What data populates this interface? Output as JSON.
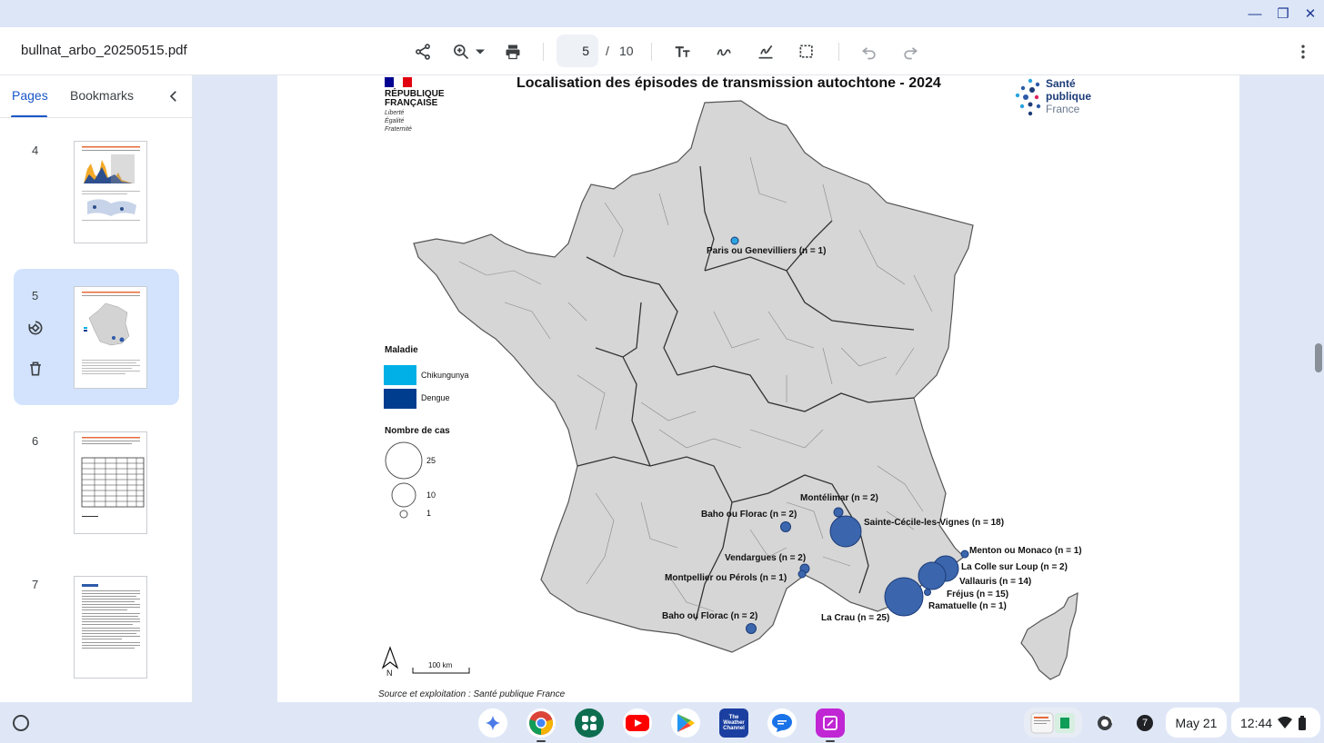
{
  "window": {
    "minimize_icon": "minimize-icon",
    "maximize_icon": "maximize-icon",
    "close_icon": "close-icon"
  },
  "toolbar": {
    "filename": "bullnat_arbo_20250515.pdf",
    "page_current": "5",
    "page_separator": "/",
    "page_total": "10"
  },
  "sidebar": {
    "tabs": [
      "Pages",
      "Bookmarks"
    ],
    "thumbnails": [
      {
        "page": "4"
      },
      {
        "page": "5",
        "selected": true
      },
      {
        "page": "6"
      },
      {
        "page": "7"
      }
    ]
  },
  "document": {
    "map_title": "Localisation des épisodes de transmission autochtone - 2024",
    "republic_logo": [
      "RÉPUBLIQUE",
      "FRANÇAISE"
    ],
    "republic_motto": [
      "Liberté",
      "Égalité",
      "Fraternité"
    ],
    "spf_logo": [
      "Santé",
      "publique",
      "France"
    ],
    "legend": {
      "disease_title": "Maladie",
      "diseases": [
        {
          "label": "Chikungunya",
          "color": "#00b0e6"
        },
        {
          "label": "Dengue",
          "color": "#003d8f"
        }
      ],
      "cases_title": "Nombre de cas",
      "case_sizes": [
        "25",
        "10",
        "1"
      ]
    },
    "map_labels": [
      "Paris ou Genevilliers (n = 1)",
      "Montélimar (n = 2)",
      "Baho ou Florac (n = 2)",
      "Sainte-Cécile-les-Vignes (n = 18)",
      "Vendargues (n = 2)",
      "Menton ou Monaco (n = 1)",
      "La Colle sur Loup (n = 2)",
      "Montpellier ou Pérols (n = 1)",
      "Vallauris (n = 14)",
      "Fréjus (n = 15)",
      "Ramatuelle (n = 1)",
      "Baho ou Florac (n = 2)",
      "La Crau (n = 25)"
    ],
    "north_label": "N",
    "scale_label": "100 km",
    "source": "Source et exploitation : Santé publique France"
  },
  "shelf": {
    "date": "May 21",
    "time": "12:44",
    "notification_count": "7",
    "weather_app_label": [
      "The",
      "Weather",
      "Channel"
    ]
  }
}
